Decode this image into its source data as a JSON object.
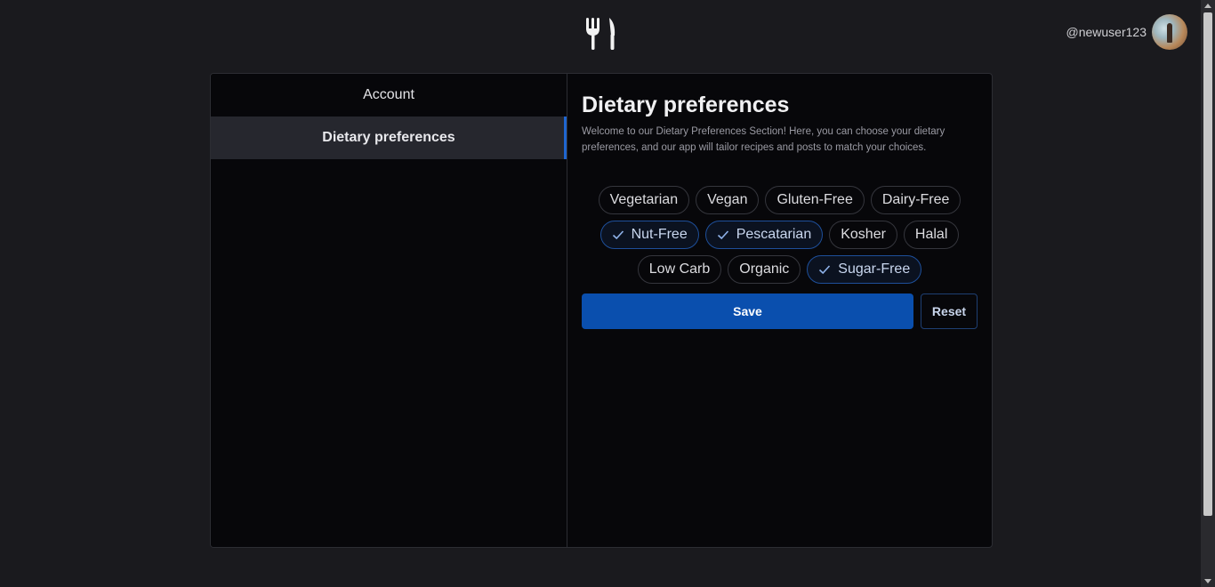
{
  "header": {
    "logo_icon": "fork-knife-icon",
    "username": "@newuser123"
  },
  "sidebar": {
    "items": [
      {
        "label": "Account",
        "active": false
      },
      {
        "label": "Dietary preferences",
        "active": true
      }
    ]
  },
  "main": {
    "title": "Dietary preferences",
    "description": "Welcome to our Dietary Preferences Section! Here, you can choose your dietary preferences, and our app will tailor recipes and posts to match your choices.",
    "options": [
      {
        "label": "Vegetarian",
        "checked": false
      },
      {
        "label": "Vegan",
        "checked": false
      },
      {
        "label": "Gluten-Free",
        "checked": false
      },
      {
        "label": "Dairy-Free",
        "checked": false
      },
      {
        "label": "Nut-Free",
        "checked": true
      },
      {
        "label": "Pescatarian",
        "checked": true
      },
      {
        "label": "Kosher",
        "checked": false
      },
      {
        "label": "Halal",
        "checked": false
      },
      {
        "label": "Low Carb",
        "checked": false
      },
      {
        "label": "Organic",
        "checked": false
      },
      {
        "label": "Sugar-Free",
        "checked": true
      }
    ],
    "save_label": "Save",
    "reset_label": "Reset"
  },
  "colors": {
    "accent": "#0a4fae",
    "active_indicator": "#1f66d1",
    "background": "#1a1a1e",
    "card": "#07070a"
  }
}
